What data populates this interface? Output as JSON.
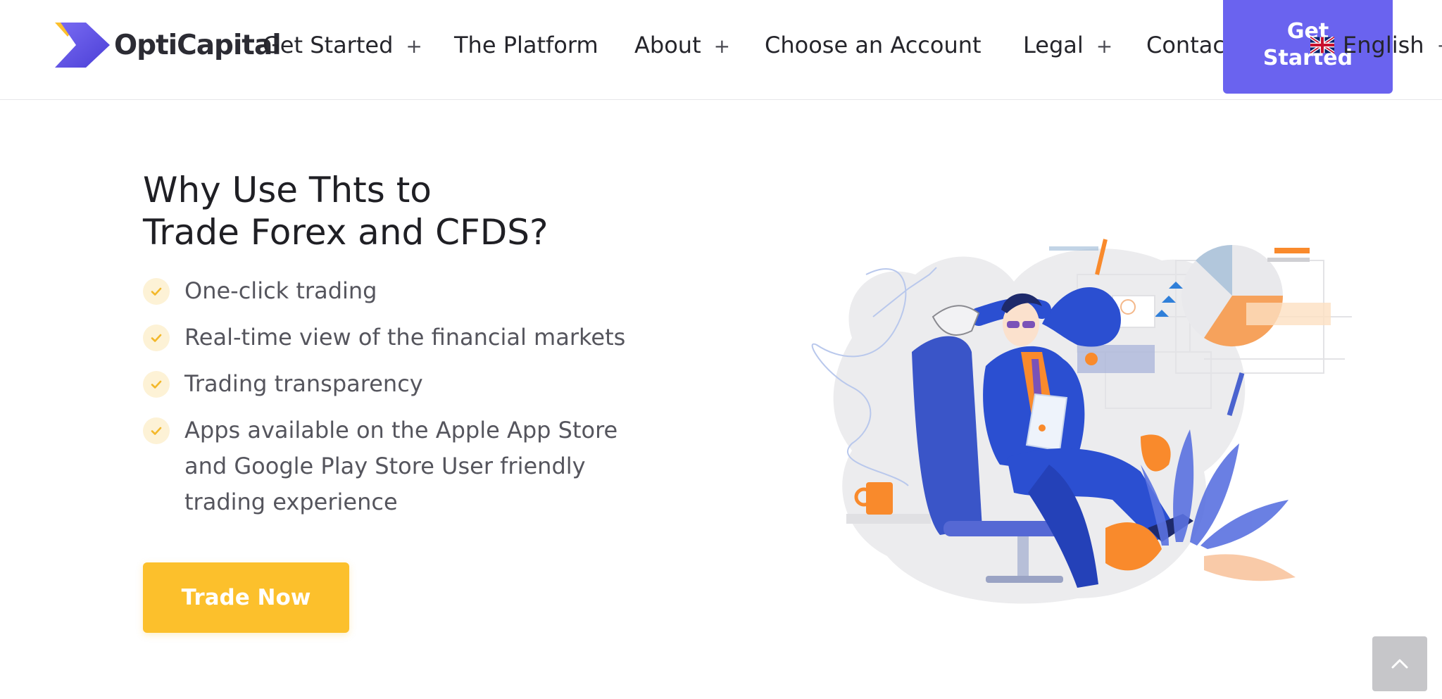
{
  "header": {
    "brand": "OptiCapital",
    "nav": [
      {
        "label": "Get Started",
        "has_submenu": true
      },
      {
        "label": "The Platform",
        "has_submenu": false
      },
      {
        "label": "About",
        "has_submenu": true
      },
      {
        "label": "Choose an Account",
        "has_submenu": false
      },
      {
        "label": "Legal",
        "has_submenu": true
      },
      {
        "label": "Contact Us",
        "has_submenu": false
      }
    ],
    "plus_symbol": "+",
    "cta_label": "Get Started",
    "language": {
      "label": "English",
      "flag_icon": "uk-flag-icon",
      "plus": "+"
    }
  },
  "hero": {
    "title_line1": "Why Use Thts to",
    "title_line2": "Trade Forex and CFDS?",
    "features": [
      "One-click trading",
      "Real-time view of the financial markets",
      "Trading transparency",
      "Apps available on the Apple App Store and Google Play Store User friendly trading experience"
    ],
    "button_label": "Trade Now"
  },
  "colors": {
    "brand_purple": "#6a63ef",
    "accent_yellow": "#fcc02c",
    "check_bg": "#fdf2d6",
    "illustration_blue": "#2b4fd1",
    "illustration_orange": "#f98a2c"
  },
  "icons": {
    "feature_check": "check-icon",
    "back_to_top": "chevron-up-icon",
    "logo": "chevron-logo-icon"
  }
}
